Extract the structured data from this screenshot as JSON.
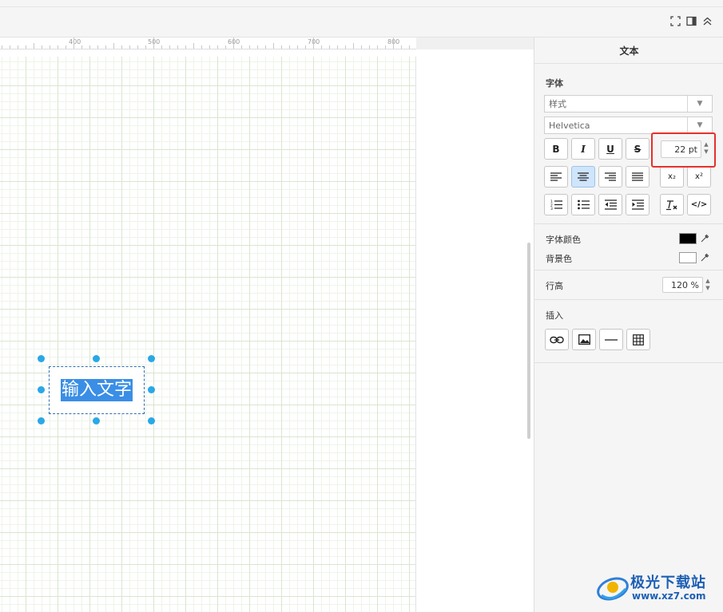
{
  "toolbar": {
    "fullscreen_icon": "fullscreen-icon",
    "panel_toggle_icon": "panel-toggle-icon",
    "collapse_icon": "collapse-up-icon"
  },
  "ruler": {
    "labels": [
      "400",
      "500",
      "600",
      "700",
      "800"
    ]
  },
  "canvas": {
    "shape_text": "输入文字"
  },
  "format_panel": {
    "title": "文本",
    "font_section": "字体",
    "style_select": "样式",
    "font_select": "Helvetica",
    "font_size": "22 pt",
    "buttons": {
      "bold": "B",
      "italic": "I",
      "underline": "U",
      "strike": "S",
      "subscript": "x₂",
      "superscript": "x²",
      "html": "</>"
    },
    "font_color_label": "字体颜色",
    "bg_color_label": "背景色",
    "line_height_label": "行高",
    "line_height_value": "120 %",
    "insert_section": "插入",
    "colors": {
      "font_color": "#000000",
      "bg_color": "#ffffff",
      "selection": "#3a8ee6",
      "handles": "#29a8e6",
      "highlight": "#e5312b"
    }
  },
  "watermark": {
    "text": "极光下载站",
    "url": "www.xz7.com"
  }
}
